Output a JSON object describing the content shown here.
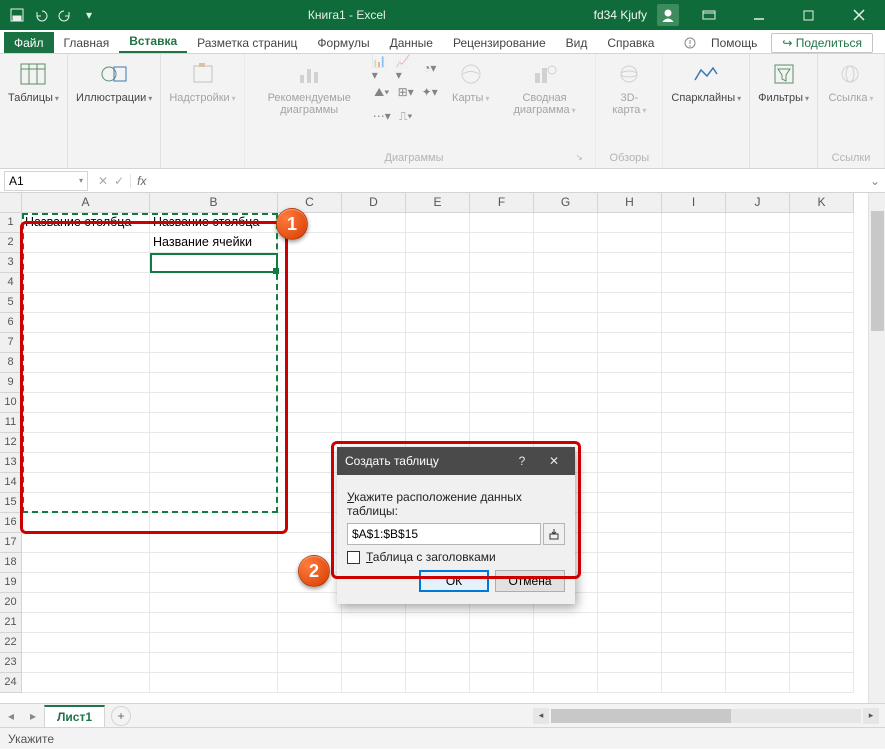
{
  "app": {
    "title": "Книга1  -  Excel",
    "user": "fd34 Kjufy"
  },
  "tabs": {
    "file": "Файл",
    "items": [
      "Главная",
      "Вставка",
      "Разметка страниц",
      "Формулы",
      "Данные",
      "Рецензирование",
      "Вид",
      "Справка"
    ],
    "active": "Вставка",
    "help": "Помощь",
    "share": "Поделиться"
  },
  "ribbon": {
    "tables": "Таблицы",
    "illustrations": "Иллюстрации",
    "addins": "Надстройки",
    "rec_charts": "Рекомендуемые диаграммы",
    "charts_group": "Диаграммы",
    "maps": "Карты",
    "pivot": "Сводная диаграмма",
    "tours_group": "Обзоры",
    "3dmap": "3D-карта",
    "sparklines": "Спарклайны",
    "filters": "Фильтры",
    "links": "Ссылка",
    "links_group": "Ссылки"
  },
  "formula_bar": {
    "name_box": "A1",
    "formula": ""
  },
  "columns": {
    "A": 128,
    "B": 128,
    "C": 64,
    "D": 64,
    "E": 64,
    "F": 64,
    "G": 64,
    "H": 64,
    "I": 64,
    "J": 64,
    "K": 64
  },
  "rows": 24,
  "cells": {
    "A1": "Название столбца",
    "B1": "Название столбца",
    "B2": "Название ячейки"
  },
  "dialog": {
    "title": "Создать таблицу",
    "prompt": "Укажите расположение данных таблицы:",
    "range": "$A$1:$B$15",
    "checkbox": "Таблица с заголовками",
    "ok": "ОК",
    "cancel": "Отмена"
  },
  "sheet": {
    "name": "Лист1"
  },
  "status": "Укажите",
  "annotations": {
    "n1": "1",
    "n2": "2"
  }
}
